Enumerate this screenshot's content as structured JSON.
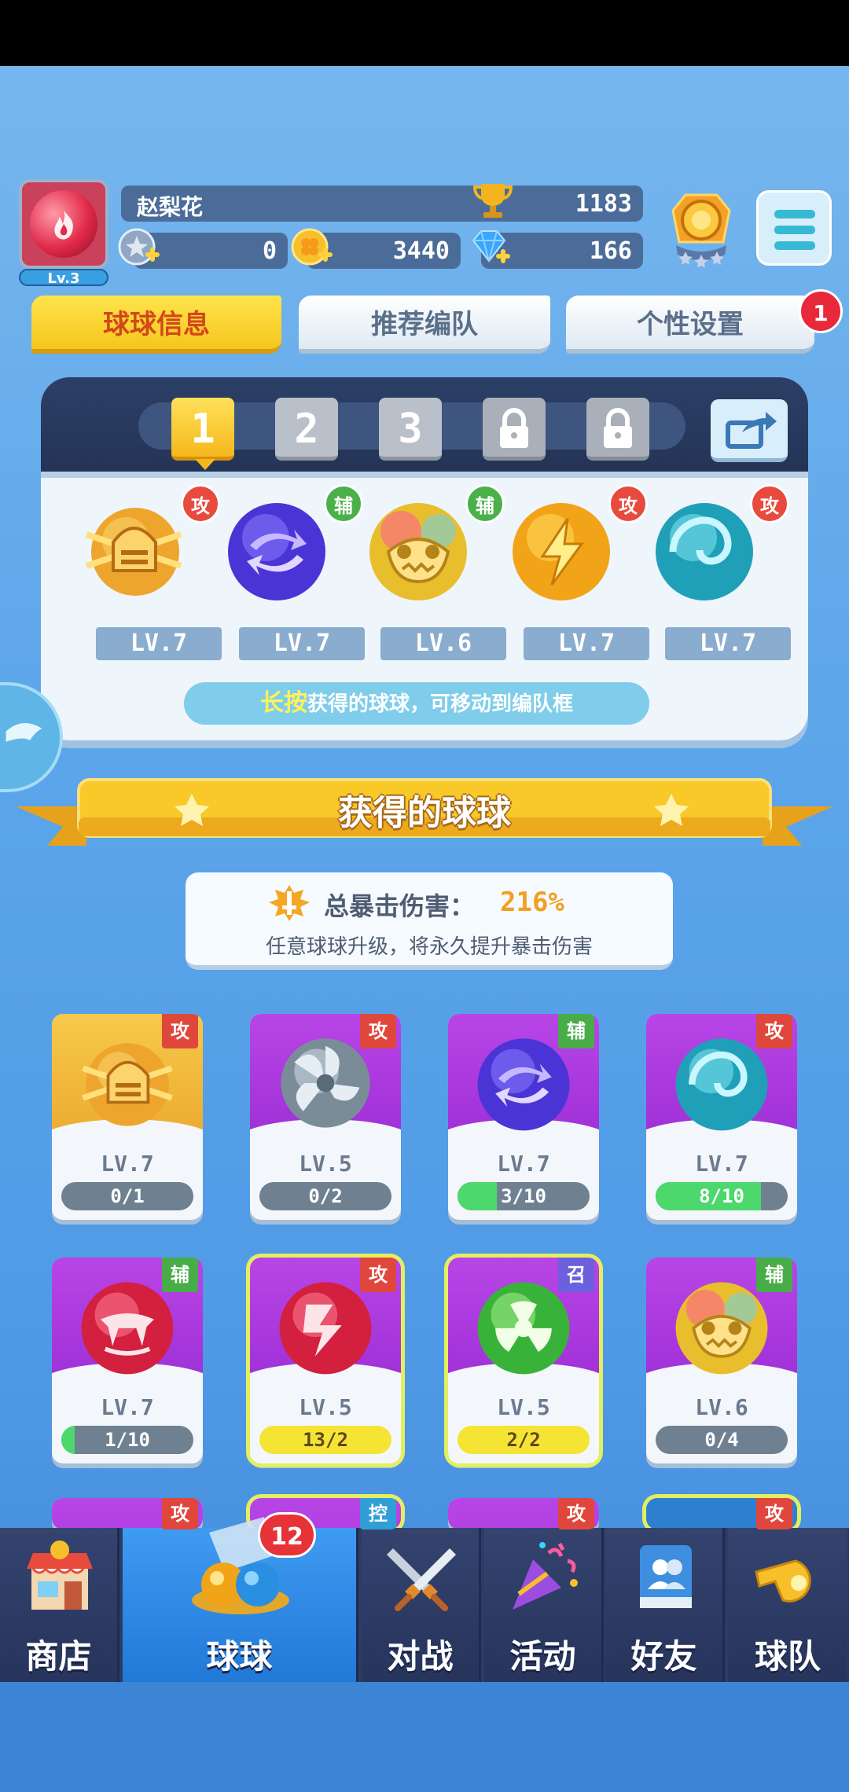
{
  "player": {
    "name": "赵梨花",
    "level": "Lv.3",
    "trophies": "1183"
  },
  "currencies": {
    "stars": "0",
    "clovers": "3440",
    "diamonds": "166"
  },
  "tabs": {
    "ball_info": "球球信息",
    "recommended_team": "推荐编队",
    "personal_settings": "个性设置",
    "settings_badge": "1"
  },
  "team_panel": {
    "slots": [
      "1",
      "2",
      "3"
    ],
    "balls": [
      {
        "role": "攻",
        "level": "LV.7",
        "icon": "knight-helmet-ball-icon"
      },
      {
        "role": "辅",
        "level": "LV.7",
        "icon": "swap-arrows-ball-icon"
      },
      {
        "role": "辅",
        "level": "LV.6",
        "icon": "monster-face-ball-icon"
      },
      {
        "role": "攻",
        "level": "LV.7",
        "icon": "lightning-ball-icon"
      },
      {
        "role": "攻",
        "level": "LV.7",
        "icon": "vortex-ball-icon"
      }
    ],
    "hint_key": "长按",
    "hint_rest": "获得的球球，可移动到编队框"
  },
  "obtained": {
    "title": "获得的球球",
    "crit_label": "总暴击伤害：",
    "crit_value": "216%",
    "crit_note": "任意球球升级，将永久提升暴击伤害"
  },
  "cards": [
    {
      "role": "攻",
      "level": "LV.7",
      "progress": "0/1",
      "fill": 0,
      "icon": "knight-helmet-ball-icon"
    },
    {
      "role": "攻",
      "level": "LV.5",
      "progress": "0/2",
      "fill": 0,
      "icon": "fan-ball-icon"
    },
    {
      "role": "辅",
      "level": "LV.7",
      "progress": "3/10",
      "fill": 0.3,
      "icon": "swap-arrows-ball-icon"
    },
    {
      "role": "攻",
      "level": "LV.7",
      "progress": "8/10",
      "fill": 0.8,
      "icon": "vortex-ball-icon"
    },
    {
      "role": "辅",
      "level": "LV.7",
      "progress": "1/10",
      "fill": 0.1,
      "icon": "fangs-ball-icon"
    },
    {
      "role": "攻",
      "level": "LV.5",
      "progress": "13/2",
      "fill": 1,
      "icon": "crack-ball-icon"
    },
    {
      "role": "召",
      "level": "LV.5",
      "progress": "2/2",
      "fill": 1,
      "icon": "radiation-ball-icon"
    },
    {
      "role": "辅",
      "level": "LV.6",
      "progress": "0/4",
      "fill": 0,
      "icon": "monster-face-ball-icon"
    }
  ],
  "peek_roles": [
    "攻",
    "控",
    "攻",
    "攻"
  ],
  "nav": {
    "shop": "商店",
    "balls": "球球",
    "battle": "对战",
    "events": "活动",
    "friends": "好友",
    "team": "球队",
    "balls_badge": "12"
  },
  "colors": {
    "attack": "#e0473c",
    "support": "#48ac48",
    "summon": "#6c60df",
    "control": "#2f9fd6",
    "accent_gold": "#f6c61c"
  }
}
